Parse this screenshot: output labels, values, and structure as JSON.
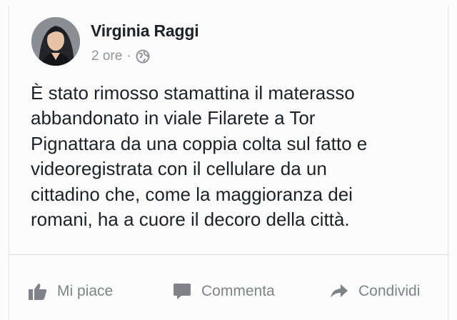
{
  "post": {
    "author": "Virginia Raggi",
    "time": "2 ore",
    "separator": "·",
    "privacy_icon": "globe-icon",
    "lines": [
      "È stato rimosso stamattina il materasso",
      "abbandonato in viale Filarete a Tor",
      "Pignattara da una coppia colta sul fatto e",
      "videoregistrata con il cellulare da un",
      "cittadino che, come la maggioranza dei",
      "romani, ha a cuore il decoro della città."
    ]
  },
  "actions": {
    "like_label": "Mi piace",
    "like_icon": "thumbs-up-icon",
    "comment_label": "Commenta",
    "comment_icon": "comment-icon",
    "share_label": "Condividi",
    "share_icon": "share-arrow-icon"
  },
  "colors": {
    "text": "#1d2129",
    "meta": "#90949c",
    "action": "#7f8389",
    "background": "#fcfcfc"
  }
}
